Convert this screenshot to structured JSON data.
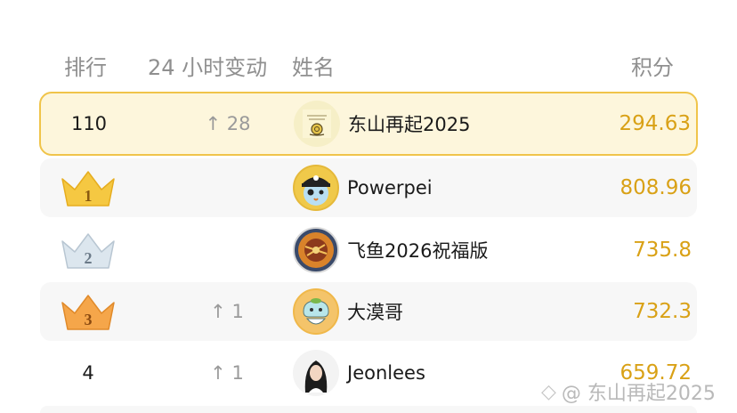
{
  "header": {
    "rank": "排行",
    "change": "24 小时变动",
    "name": "姓名",
    "score": "积分"
  },
  "me": {
    "rank": "110",
    "change": "↑ 28",
    "name": "东山再起2025",
    "score": "294.63"
  },
  "rows": [
    {
      "rank": "1",
      "change": "",
      "name": "Powerpei",
      "score": "808.96",
      "crown": "gold-crown-icon"
    },
    {
      "rank": "2",
      "change": "",
      "name": "飞鱼2026祝福版",
      "score": "735.8",
      "crown": "silver-crown-icon"
    },
    {
      "rank": "3",
      "change": "↑ 1",
      "name": "大漠哥",
      "score": "732.3",
      "crown": "bronze-crown-icon"
    },
    {
      "rank": "4",
      "change": "↑ 1",
      "name": "Jeonlees",
      "score": "659.72"
    }
  ],
  "watermark": {
    "icon": "diamond-logo-icon",
    "text": "@ 东山再起2025"
  },
  "colors": {
    "accent_gold": "#d9a116",
    "highlight_bg": "#fdf6dc",
    "highlight_border": "#f0c44a",
    "muted_text": "#8f8f8f"
  }
}
